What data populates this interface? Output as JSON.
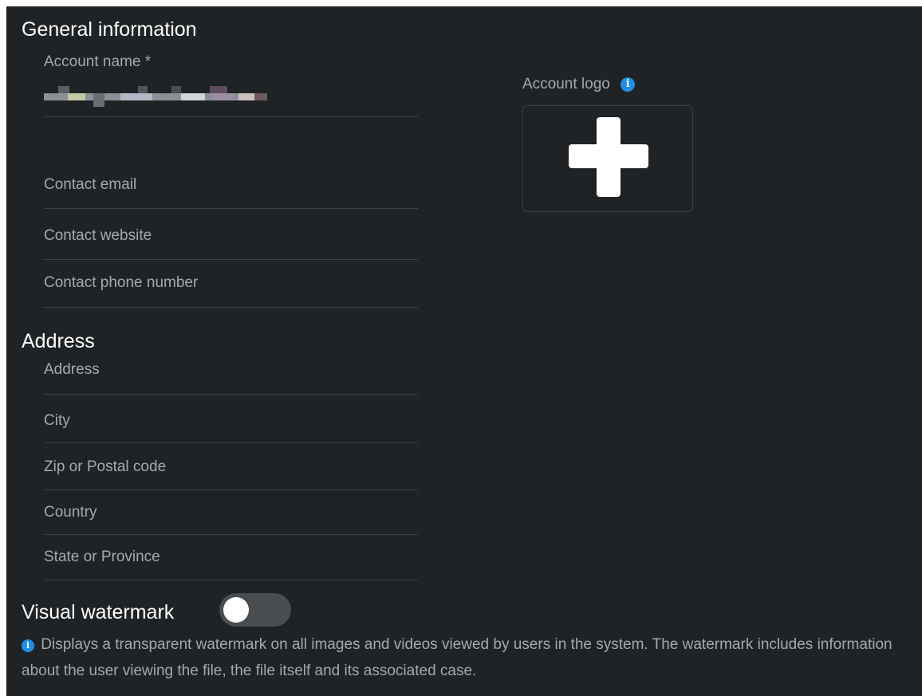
{
  "general": {
    "title": "General information",
    "account_name_label": "Account name *",
    "contact_email_label": "Contact email",
    "contact_website_label": "Contact website",
    "contact_phone_label": "Contact phone number"
  },
  "logo": {
    "label": "Account logo",
    "info_icon": "info-icon",
    "add_icon": "plus-icon"
  },
  "address": {
    "title": "Address",
    "address_label": "Address",
    "city_label": "City",
    "zip_label": "Zip or Postal code",
    "country_label": "Country",
    "state_label": "State or Province"
  },
  "watermark": {
    "title": "Visual watermark",
    "enabled": false,
    "description": "Displays a transparent watermark on all images and videos viewed by users in the system. The watermark includes information about the user viewing the file, the file itself and its associated case."
  },
  "colors": {
    "background": "#202325",
    "accent": "#1e8fe6",
    "heading": "#ffffff",
    "label": "#a6a8ab",
    "divider": "#3c4043",
    "toggle_track": "#4a4d50"
  }
}
